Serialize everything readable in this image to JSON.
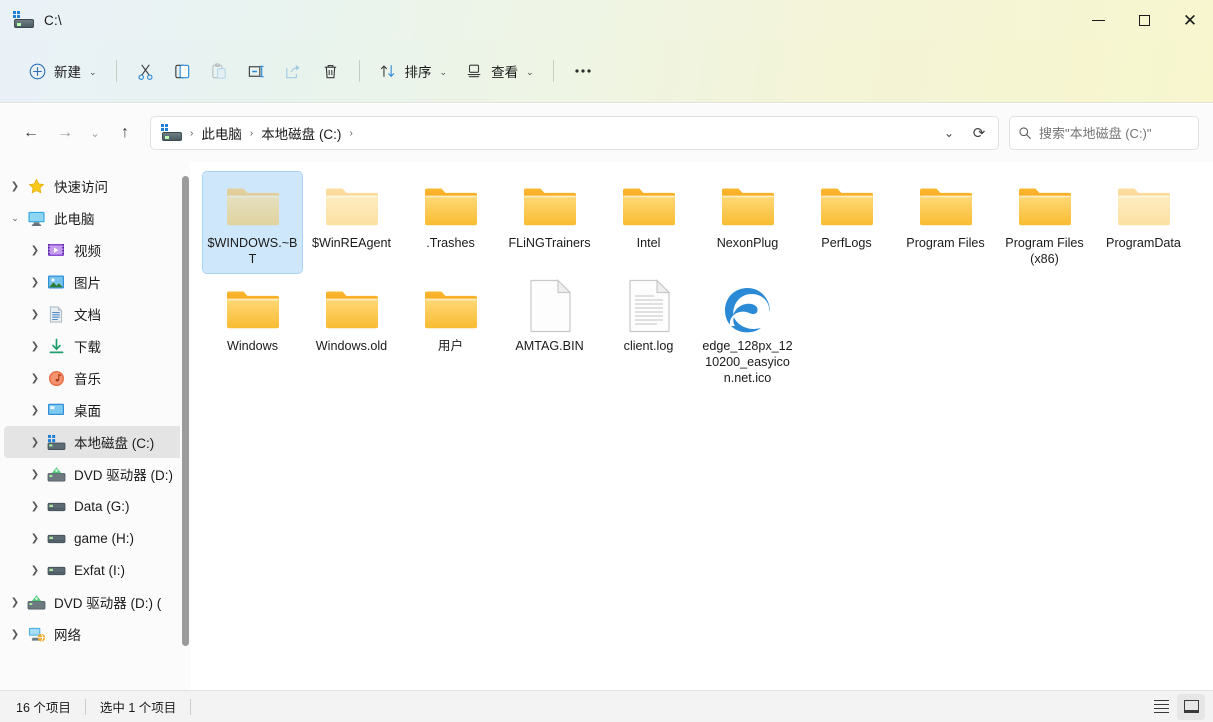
{
  "window": {
    "title": "C:\\",
    "icon": "local-disk-icon",
    "controls": {
      "minimize": "—",
      "maximize": "▢",
      "close": "✕"
    }
  },
  "commandbar": {
    "new_label": "新建",
    "cut_label": "剪切",
    "copy_label": "复制",
    "paste_label": "粘贴",
    "rename_label": "重命名",
    "share_label": "共享",
    "delete_label": "删除",
    "sort_label": "排序",
    "view_label": "查看",
    "more_label": "···"
  },
  "nav": {
    "back": "←",
    "forward": "→",
    "recent": "⌄",
    "up": "↑",
    "breadcrumbs": [
      "此电脑",
      "本地磁盘 (C:)"
    ],
    "separator": "›",
    "dropdown": "⌄",
    "refresh": "⟳"
  },
  "search": {
    "placeholder": "搜索\"本地磁盘 (C:)\"",
    "value": "",
    "icon": "search-icon"
  },
  "sidebar": {
    "items": [
      {
        "label": "快速访问",
        "icon": "star-icon",
        "level": 1,
        "expanded": false,
        "selected": false
      },
      {
        "label": "此电脑",
        "icon": "computer-icon",
        "level": 1,
        "expanded": true,
        "selected": false
      },
      {
        "label": "视频",
        "icon": "videos-icon",
        "level": 2,
        "expanded": false,
        "selected": false
      },
      {
        "label": "图片",
        "icon": "pictures-icon",
        "level": 2,
        "expanded": false,
        "selected": false
      },
      {
        "label": "文档",
        "icon": "documents-icon",
        "level": 2,
        "expanded": false,
        "selected": false
      },
      {
        "label": "下载",
        "icon": "downloads-icon",
        "level": 2,
        "expanded": false,
        "selected": false
      },
      {
        "label": "音乐",
        "icon": "music-icon",
        "level": 2,
        "expanded": false,
        "selected": false
      },
      {
        "label": "桌面",
        "icon": "desktop-icon",
        "level": 2,
        "expanded": false,
        "selected": false
      },
      {
        "label": "本地磁盘 (C:)",
        "icon": "local-disk-icon",
        "level": 2,
        "expanded": false,
        "selected": true
      },
      {
        "label": "DVD 驱动器 (D:)",
        "icon": "dvd-drive-icon",
        "level": 2,
        "expanded": false,
        "selected": false
      },
      {
        "label": "Data (G:)",
        "icon": "drive-icon",
        "level": 2,
        "expanded": false,
        "selected": false
      },
      {
        "label": "game (H:)",
        "icon": "drive-icon",
        "level": 2,
        "expanded": false,
        "selected": false
      },
      {
        "label": "Exfat (I:)",
        "icon": "drive-icon",
        "level": 2,
        "expanded": false,
        "selected": false
      },
      {
        "label": "DVD 驱动器 (D:) (",
        "icon": "dvd-drive-icon",
        "level": 1,
        "expanded": false,
        "selected": false
      },
      {
        "label": "网络",
        "icon": "network-icon",
        "level": 1,
        "expanded": false,
        "selected": false
      }
    ]
  },
  "files": [
    {
      "name": "$WINDOWS.~BT",
      "type": "folder",
      "hidden": true,
      "selected": true
    },
    {
      "name": "$WinREAgent",
      "type": "folder",
      "hidden": true,
      "selected": false
    },
    {
      "name": ".Trashes",
      "type": "folder",
      "hidden": false,
      "selected": false
    },
    {
      "name": "FLiNGTrainers",
      "type": "folder",
      "hidden": false,
      "selected": false
    },
    {
      "name": "Intel",
      "type": "folder",
      "hidden": false,
      "selected": false
    },
    {
      "name": "NexonPlug",
      "type": "folder",
      "hidden": false,
      "selected": false
    },
    {
      "name": "PerfLogs",
      "type": "folder",
      "hidden": false,
      "selected": false
    },
    {
      "name": "Program Files",
      "type": "folder",
      "hidden": false,
      "selected": false
    },
    {
      "name": "Program Files (x86)",
      "type": "folder",
      "hidden": false,
      "selected": false
    },
    {
      "name": "ProgramData",
      "type": "folder",
      "hidden": true,
      "selected": false
    },
    {
      "name": "Windows",
      "type": "folder",
      "hidden": false,
      "selected": false
    },
    {
      "name": "Windows.old",
      "type": "folder",
      "hidden": false,
      "selected": false
    },
    {
      "name": "用户",
      "type": "folder",
      "hidden": false,
      "selected": false
    },
    {
      "name": "AMTAG.BIN",
      "type": "file-blank",
      "hidden": false,
      "selected": false
    },
    {
      "name": "client.log",
      "type": "file-text",
      "hidden": false,
      "selected": false
    },
    {
      "name": "edge_128px_1210200_easyicon.net.ico",
      "type": "edge-icon",
      "hidden": false,
      "selected": false
    }
  ],
  "statusbar": {
    "item_count": "16 个项目",
    "selection": "选中 1 个项目",
    "view_details": "details-view-button",
    "view_large_icons": "large-icons-view-button"
  }
}
